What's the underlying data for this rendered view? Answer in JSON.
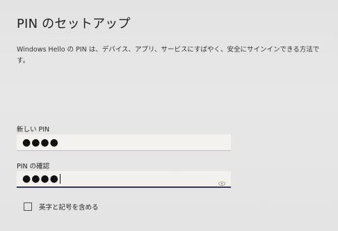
{
  "dialog": {
    "title": "PIN のセットアップ",
    "description": "Windows Hello の PIN は、デバイス、アプリ、サービスにすばやく、安全にサインインできる方法です。"
  },
  "new_pin": {
    "label": "新しい PIN",
    "masked_value": "●●●●"
  },
  "confirm_pin": {
    "label": "PIN の確認",
    "masked_value": "●●●●",
    "reveal_icon": "eye-icon"
  },
  "options": {
    "include_letters_symbols": {
      "label": "英字と記号を含める",
      "checked": false
    }
  },
  "colors": {
    "background": "#e5e5e5",
    "input_background": "#f4f2ef",
    "focus_underline": "#333a55"
  }
}
